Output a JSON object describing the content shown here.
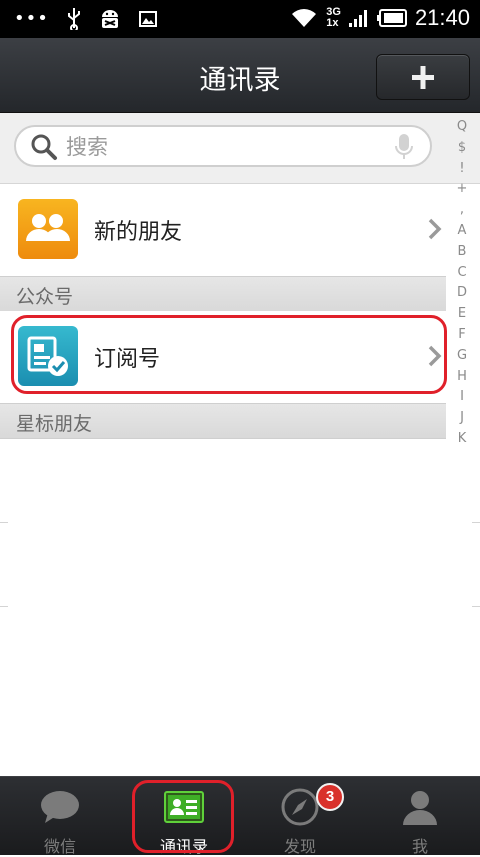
{
  "status_bar": {
    "time": "21:40",
    "network_top": "3G",
    "network_bottom": "1x",
    "overflow_dots": "•••"
  },
  "header": {
    "title": "通讯录",
    "add_icon": "plus-icon"
  },
  "search": {
    "placeholder": "搜索",
    "value": "",
    "icons": [
      "search-icon",
      "mic-icon"
    ]
  },
  "rows": {
    "new_friends": {
      "label": "新的朋友",
      "icon": "people-icon"
    },
    "subscriptions": {
      "label": "订阅号",
      "icon": "subscription-icon"
    }
  },
  "sections": {
    "official_accounts": "公众号",
    "starred_friends": "星标朋友"
  },
  "index_letters": [
    "Q",
    "$",
    "!",
    "+",
    ",",
    "A",
    "B",
    "C",
    "D",
    "E",
    "F",
    "G",
    "H",
    "I",
    "J",
    "K"
  ],
  "tabs": [
    {
      "label": "微信",
      "icon": "chat-bubble-icon",
      "active": false
    },
    {
      "label": "通讯录",
      "icon": "contacts-card-icon",
      "active": true
    },
    {
      "label": "发现",
      "icon": "compass-icon",
      "active": false,
      "badge": "3"
    },
    {
      "label": "我",
      "icon": "person-icon",
      "active": false
    }
  ],
  "colors": {
    "accent_green": "#4caf2a",
    "highlight_red": "#e0202a",
    "badge_red": "#d9312b"
  }
}
